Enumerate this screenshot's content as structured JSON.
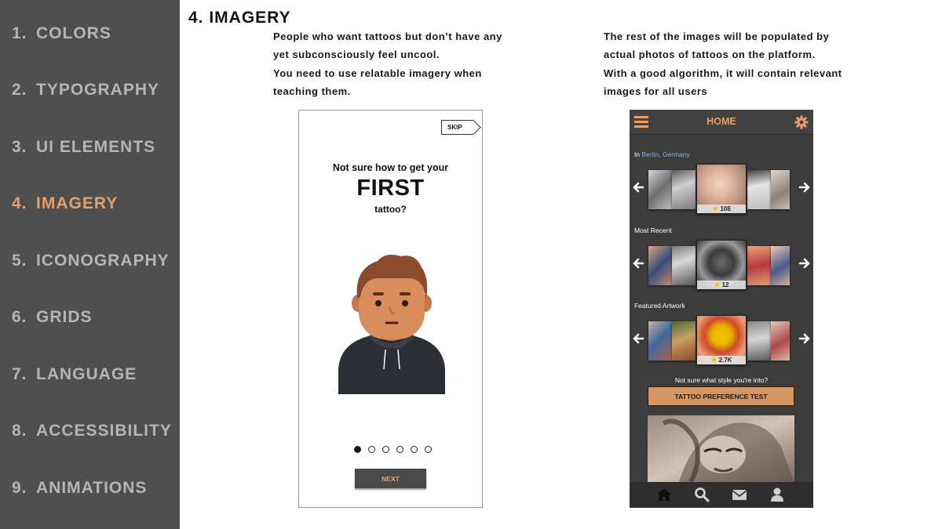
{
  "sidebar": {
    "items": [
      {
        "num": "1.",
        "label": "COLORS"
      },
      {
        "num": "2.",
        "label": "TYPOGRAPHY"
      },
      {
        "num": "3.",
        "label": "UI ELEMENTS"
      },
      {
        "num": "4.",
        "label": "IMAGERY"
      },
      {
        "num": "5.",
        "label": "ICONOGRAPHY"
      },
      {
        "num": "6.",
        "label": "GRIDS"
      },
      {
        "num": "7.",
        "label": "LANGUAGE"
      },
      {
        "num": "8.",
        "label": "ACCESSIBILITY"
      },
      {
        "num": "9.",
        "label": "ANIMATIONS"
      }
    ],
    "active_item": "IMAGERY"
  },
  "section": {
    "title": "4. IMAGERY",
    "left_desc": [
      "People who want tattoos but don’t have any",
      "yet subconsciously feel uncool.",
      "You need to use relatable imagery when",
      "teaching them."
    ],
    "right_desc": [
      "The rest of the images will be populated by",
      "actual photos of tattoos on the platform.",
      "With a good algorithm, it will contain relevant",
      "images for all users"
    ]
  },
  "onboarding": {
    "skip_label": "SKIP",
    "line1": "Not sure how to get your",
    "line2": "FIRST",
    "line3": "tattoo?",
    "page_count": 6,
    "current_page": 1,
    "next_label": "NEXT"
  },
  "app": {
    "title": "HOME",
    "location_prefix": "In",
    "location": "Berlin, Germany",
    "rows": [
      {
        "label": "Most Recent",
        "rating": "12"
      },
      {
        "label": "Featured Artwork",
        "rating": "2.7K"
      }
    ],
    "location_rating": "108",
    "pref_prompt": "Not sure what style you're into?",
    "pref_button": "TATTOO PREFERENCE TEST",
    "bottom_nav": [
      "home-icon",
      "search-icon",
      "mail-icon",
      "profile-icon"
    ]
  },
  "colors": {
    "accent": "#e3a06a",
    "sidebar_bg": "#4f4f4f",
    "sidebar_text": "#b5b5b5",
    "app_bg": "#3c3c3c",
    "link": "#7fb6ef"
  }
}
